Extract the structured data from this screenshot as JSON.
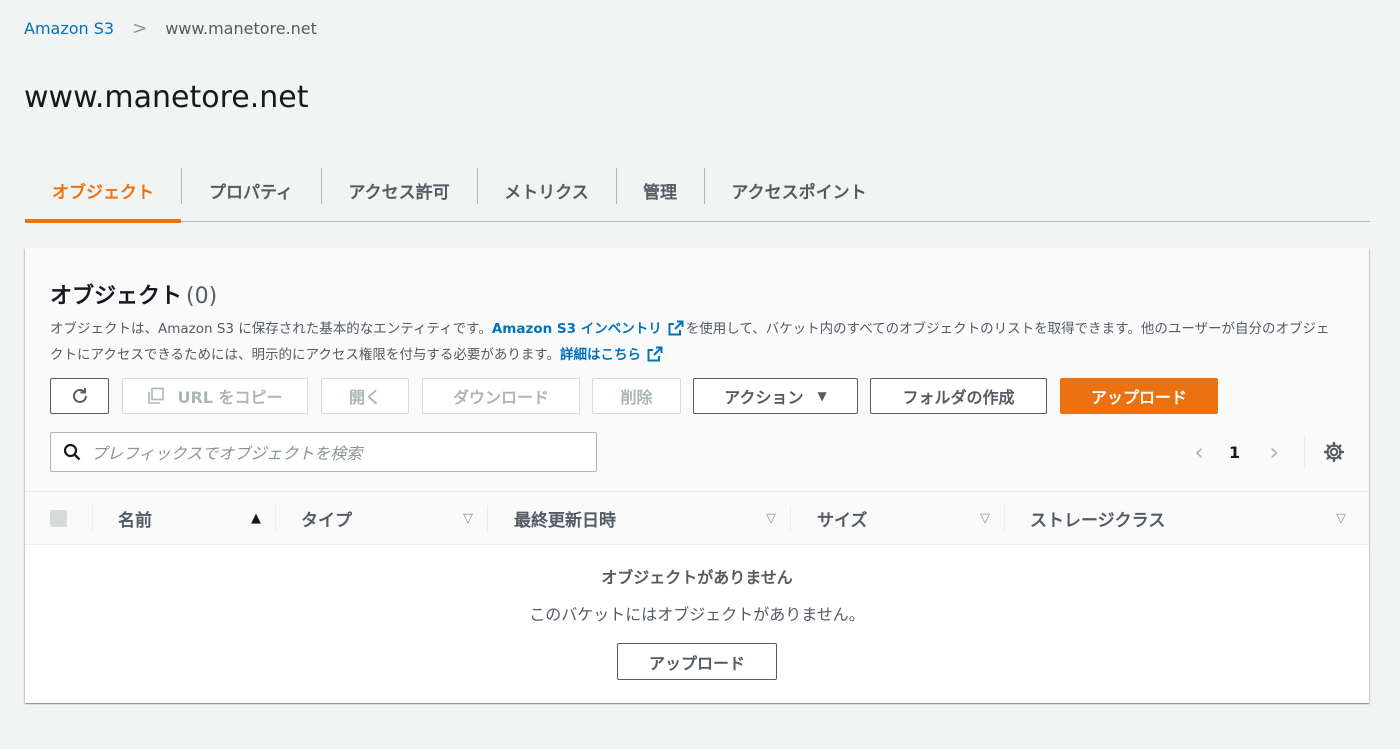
{
  "breadcrumb": {
    "root": "Amazon S3",
    "separator": ">",
    "current": "www.manetore.net"
  },
  "page_title": "www.manetore.net",
  "tabs": [
    {
      "label": "オブジェクト",
      "active": true
    },
    {
      "label": "プロパティ"
    },
    {
      "label": "アクセス許可"
    },
    {
      "label": "メトリクス"
    },
    {
      "label": "管理"
    },
    {
      "label": "アクセスポイント"
    }
  ],
  "objects_panel": {
    "title": "オブジェクト",
    "count": "(0)",
    "description": {
      "part1": "オブジェクトは、Amazon S3 に保存された基本的なエンティティです。",
      "inventory_link": "Amazon S3 インベントリ",
      "part2": "を使用して、バケット内のすべてのオブジェクトのリストを取得できます。他のユーザーが自分のオブジェクトにアクセスできるためには、明示的にアクセス権限を付与する必要があります。",
      "details_link": "詳細はこちら"
    },
    "toolbar": {
      "copy_url": "URL をコピー",
      "open": "開く",
      "download": "ダウンロード",
      "delete": "削除",
      "actions": "アクション",
      "create_folder": "フォルダの作成",
      "upload": "アップロード"
    },
    "search": {
      "placeholder": "プレフィックスでオブジェクトを検索"
    },
    "pagination": {
      "current_page": "1"
    },
    "table": {
      "columns": [
        "名前",
        "タイプ",
        "最終更新日時",
        "サイズ",
        "ストレージクラス"
      ]
    },
    "empty_state": {
      "title": "オブジェクトがありません",
      "description": "このバケットにはオブジェクトがありません。",
      "button": "アップロード"
    }
  },
  "colors": {
    "accent": "#ec7211",
    "link": "#0073bb",
    "background": "#f2f3f3"
  }
}
